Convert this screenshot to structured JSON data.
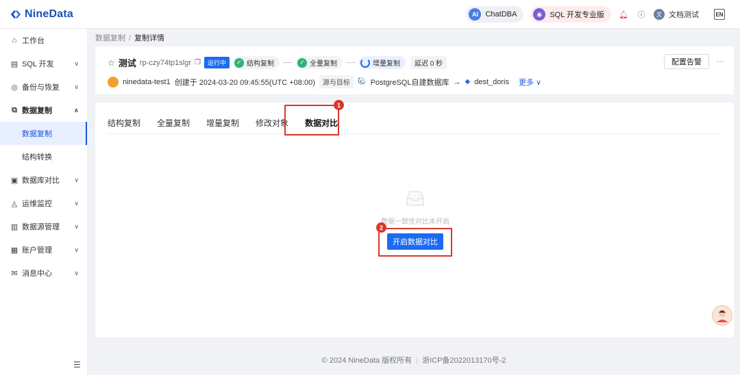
{
  "header": {
    "logo_text": "NineData",
    "chatdba_label": "ChatDBA",
    "chatdba_icon_text": "AI",
    "sql_pro_label": "SQL 开发专业版",
    "user_name": "文档测试",
    "user_initial": "文",
    "lang_icon_text": "EN",
    "brand_color": "#1a4fb3"
  },
  "sidebar": {
    "items": [
      {
        "label": "工作台",
        "icon": "home-icon"
      },
      {
        "label": "SQL 开发",
        "icon": "sql-icon"
      },
      {
        "label": "备份与恢复",
        "icon": "backup-icon"
      },
      {
        "label": "数据复制",
        "icon": "replication-icon"
      },
      {
        "label": "数据库对比",
        "icon": "compare-icon"
      },
      {
        "label": "运维监控",
        "icon": "monitor-icon"
      },
      {
        "label": "数据源管理",
        "icon": "datasource-icon"
      },
      {
        "label": "账户管理",
        "icon": "account-icon"
      },
      {
        "label": "消息中心",
        "icon": "message-icon"
      }
    ],
    "sub_items": [
      "数据复制",
      "结构转换"
    ]
  },
  "breadcrumb": {
    "parent": "数据复制",
    "sep": "/",
    "current": "复制详情"
  },
  "task": {
    "name": "测试",
    "id": "rp-czy74tp1slgr",
    "status": "运行中",
    "stages": [
      "结构复制",
      "全量复制",
      "增量复制"
    ],
    "delay": "延迟 0 秒",
    "creator": "ninedata-test1",
    "created": "创建于 2024-03-20 09:45:55(UTC +08:00)",
    "src_label": "源与目标",
    "source": "PostgreSQL自建数据库",
    "arrow": "→",
    "target": "dest_doris",
    "more": "更多 ∨",
    "alarm_btn": "配置告警",
    "dots": "···"
  },
  "tabs": [
    "结构复制",
    "全量复制",
    "增量复制",
    "修改对象",
    "数据对比"
  ],
  "active_tab": "数据对比",
  "empty": {
    "text": "数据一致性对比未开启",
    "button": "开启数据对比"
  },
  "annotations": {
    "step1": "1",
    "step2": "2",
    "color": "#d9362b"
  },
  "footer": {
    "copyright": "© 2024 NineData 版权所有",
    "icp": "浙ICP备2022013170号-2"
  }
}
